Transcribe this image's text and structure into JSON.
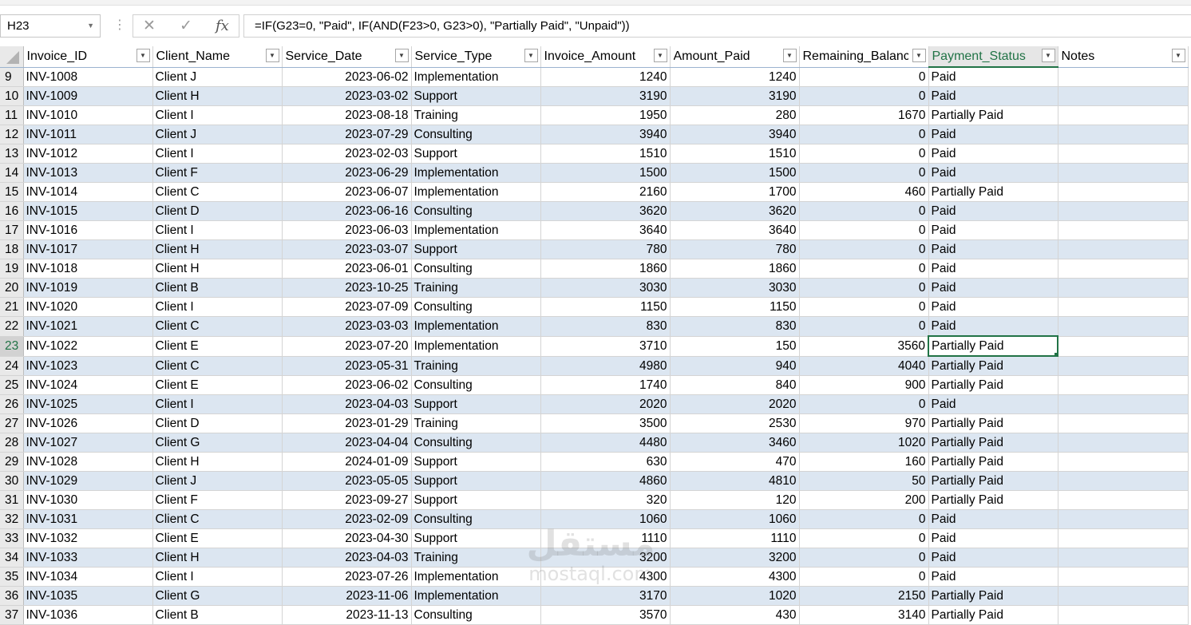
{
  "formula_bar": {
    "name_box": "H23",
    "formula": "=IF(G23=0, \"Paid\", IF(AND(F23>0, G23>0), \"Partially Paid\", \"Unpaid\"))",
    "cancel_icon": "x-icon",
    "enter_icon": "check-icon",
    "fx_label": "fx"
  },
  "headers": [
    "Invoice_ID",
    "Client_Name",
    "Service_Date",
    "Service_Type",
    "Invoice_Amount",
    "Amount_Paid",
    "Remaining_Balance",
    "Payment_Status",
    "Notes"
  ],
  "rows": [
    {
      "n": "9",
      "id": "INV-1008",
      "client": "Client J",
      "date": "2023-06-02",
      "type": "Implementation",
      "amount": "1240",
      "paid": "1240",
      "remaining": "0",
      "status": "Paid"
    },
    {
      "n": "10",
      "id": "INV-1009",
      "client": "Client H",
      "date": "2023-03-02",
      "type": "Support",
      "amount": "3190",
      "paid": "3190",
      "remaining": "0",
      "status": "Paid"
    },
    {
      "n": "11",
      "id": "INV-1010",
      "client": "Client I",
      "date": "2023-08-18",
      "type": "Training",
      "amount": "1950",
      "paid": "280",
      "remaining": "1670",
      "status": "Partially Paid"
    },
    {
      "n": "12",
      "id": "INV-1011",
      "client": "Client J",
      "date": "2023-07-29",
      "type": "Consulting",
      "amount": "3940",
      "paid": "3940",
      "remaining": "0",
      "status": "Paid"
    },
    {
      "n": "13",
      "id": "INV-1012",
      "client": "Client I",
      "date": "2023-02-03",
      "type": "Support",
      "amount": "1510",
      "paid": "1510",
      "remaining": "0",
      "status": "Paid"
    },
    {
      "n": "14",
      "id": "INV-1013",
      "client": "Client F",
      "date": "2023-06-29",
      "type": "Implementation",
      "amount": "1500",
      "paid": "1500",
      "remaining": "0",
      "status": "Paid"
    },
    {
      "n": "15",
      "id": "INV-1014",
      "client": "Client C",
      "date": "2023-06-07",
      "type": "Implementation",
      "amount": "2160",
      "paid": "1700",
      "remaining": "460",
      "status": "Partially Paid"
    },
    {
      "n": "16",
      "id": "INV-1015",
      "client": "Client D",
      "date": "2023-06-16",
      "type": "Consulting",
      "amount": "3620",
      "paid": "3620",
      "remaining": "0",
      "status": "Paid"
    },
    {
      "n": "17",
      "id": "INV-1016",
      "client": "Client I",
      "date": "2023-06-03",
      "type": "Implementation",
      "amount": "3640",
      "paid": "3640",
      "remaining": "0",
      "status": "Paid"
    },
    {
      "n": "18",
      "id": "INV-1017",
      "client": "Client H",
      "date": "2023-03-07",
      "type": "Support",
      "amount": "780",
      "paid": "780",
      "remaining": "0",
      "status": "Paid"
    },
    {
      "n": "19",
      "id": "INV-1018",
      "client": "Client H",
      "date": "2023-06-01",
      "type": "Consulting",
      "amount": "1860",
      "paid": "1860",
      "remaining": "0",
      "status": "Paid"
    },
    {
      "n": "20",
      "id": "INV-1019",
      "client": "Client B",
      "date": "2023-10-25",
      "type": "Training",
      "amount": "3030",
      "paid": "3030",
      "remaining": "0",
      "status": "Paid"
    },
    {
      "n": "21",
      "id": "INV-1020",
      "client": "Client I",
      "date": "2023-07-09",
      "type": "Consulting",
      "amount": "1150",
      "paid": "1150",
      "remaining": "0",
      "status": "Paid"
    },
    {
      "n": "22",
      "id": "INV-1021",
      "client": "Client C",
      "date": "2023-03-03",
      "type": "Implementation",
      "amount": "830",
      "paid": "830",
      "remaining": "0",
      "status": "Paid"
    },
    {
      "n": "23",
      "id": "INV-1022",
      "client": "Client E",
      "date": "2023-07-20",
      "type": "Implementation",
      "amount": "3710",
      "paid": "150",
      "remaining": "3560",
      "status": "Partially Paid"
    },
    {
      "n": "24",
      "id": "INV-1023",
      "client": "Client C",
      "date": "2023-05-31",
      "type": "Training",
      "amount": "4980",
      "paid": "940",
      "remaining": "4040",
      "status": "Partially Paid"
    },
    {
      "n": "25",
      "id": "INV-1024",
      "client": "Client E",
      "date": "2023-06-02",
      "type": "Consulting",
      "amount": "1740",
      "paid": "840",
      "remaining": "900",
      "status": "Partially Paid"
    },
    {
      "n": "26",
      "id": "INV-1025",
      "client": "Client I",
      "date": "2023-04-03",
      "type": "Support",
      "amount": "2020",
      "paid": "2020",
      "remaining": "0",
      "status": "Paid"
    },
    {
      "n": "27",
      "id": "INV-1026",
      "client": "Client D",
      "date": "2023-01-29",
      "type": "Training",
      "amount": "3500",
      "paid": "2530",
      "remaining": "970",
      "status": "Partially Paid"
    },
    {
      "n": "28",
      "id": "INV-1027",
      "client": "Client G",
      "date": "2023-04-04",
      "type": "Consulting",
      "amount": "4480",
      "paid": "3460",
      "remaining": "1020",
      "status": "Partially Paid"
    },
    {
      "n": "29",
      "id": "INV-1028",
      "client": "Client H",
      "date": "2024-01-09",
      "type": "Support",
      "amount": "630",
      "paid": "470",
      "remaining": "160",
      "status": "Partially Paid"
    },
    {
      "n": "30",
      "id": "INV-1029",
      "client": "Client J",
      "date": "2023-05-05",
      "type": "Support",
      "amount": "4860",
      "paid": "4810",
      "remaining": "50",
      "status": "Partially Paid"
    },
    {
      "n": "31",
      "id": "INV-1030",
      "client": "Client F",
      "date": "2023-09-27",
      "type": "Support",
      "amount": "320",
      "paid": "120",
      "remaining": "200",
      "status": "Partially Paid"
    },
    {
      "n": "32",
      "id": "INV-1031",
      "client": "Client C",
      "date": "2023-02-09",
      "type": "Consulting",
      "amount": "1060",
      "paid": "1060",
      "remaining": "0",
      "status": "Paid"
    },
    {
      "n": "33",
      "id": "INV-1032",
      "client": "Client E",
      "date": "2023-04-30",
      "type": "Support",
      "amount": "1110",
      "paid": "1110",
      "remaining": "0",
      "status": "Paid"
    },
    {
      "n": "34",
      "id": "INV-1033",
      "client": "Client H",
      "date": "2023-04-03",
      "type": "Training",
      "amount": "3200",
      "paid": "3200",
      "remaining": "0",
      "status": "Paid"
    },
    {
      "n": "35",
      "id": "INV-1034",
      "client": "Client I",
      "date": "2023-07-26",
      "type": "Implementation",
      "amount": "4300",
      "paid": "4300",
      "remaining": "0",
      "status": "Paid"
    },
    {
      "n": "36",
      "id": "INV-1035",
      "client": "Client G",
      "date": "2023-11-06",
      "type": "Implementation",
      "amount": "3170",
      "paid": "1020",
      "remaining": "2150",
      "status": "Partially Paid"
    },
    {
      "n": "37",
      "id": "INV-1036",
      "client": "Client B",
      "date": "2023-11-13",
      "type": "Consulting",
      "amount": "3570",
      "paid": "430",
      "remaining": "3140",
      "status": "Partially Paid"
    }
  ],
  "selection": {
    "row": "23",
    "column": "Payment_Status"
  },
  "watermark": {
    "arabic": "مستقل",
    "latin": "mostaql.com"
  },
  "colors": {
    "band": "#dce6f1",
    "active_border": "#217346",
    "header_bg": "#e9e9e9"
  }
}
